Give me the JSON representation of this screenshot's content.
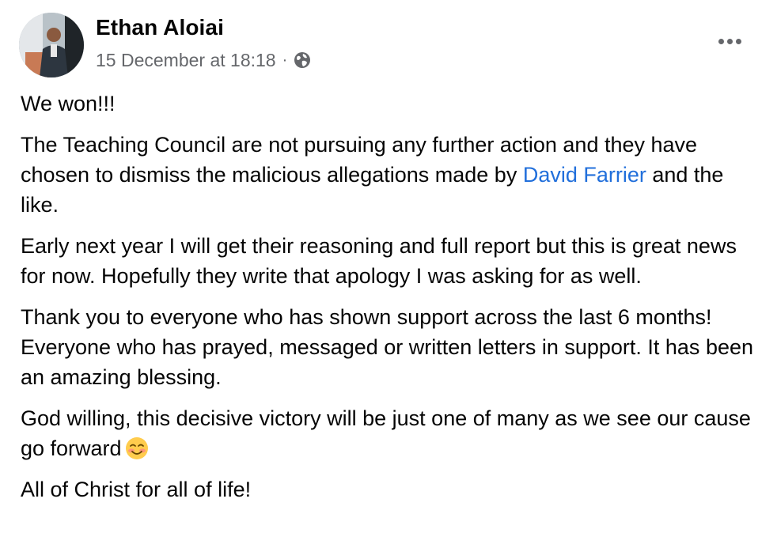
{
  "post": {
    "author": "Ethan Aloiai",
    "timestamp": "15 December at 18:18",
    "separator": "·",
    "audience_icon": "globe-icon",
    "more_icon": "more-options-icon",
    "paragraphs": {
      "p1": "We won!!!",
      "p2_before": "The Teaching Council are not pursuing any further action and they have chosen to dismiss the malicious allegations made by ",
      "p2_link": "David Farrier",
      "p2_after": " and the like.",
      "p3": "Early next year I will get their reasoning and full report but this is great news for now. Hopefully they write that apology I was asking for as well.",
      "p4": "Thank you to everyone who has shown support across the last 6 months! Everyone who has prayed, messaged or written letters in support. It has been an amazing blessing.",
      "p5": "God willing, this decisive victory will be just one of many as we see our cause go forward",
      "p5_emoji": "smiling-blushing-face-emoji",
      "p6": "All of Christ for all of life!"
    }
  },
  "colors": {
    "text": "#050505",
    "secondary": "#65676b",
    "link": "#216fdb"
  }
}
